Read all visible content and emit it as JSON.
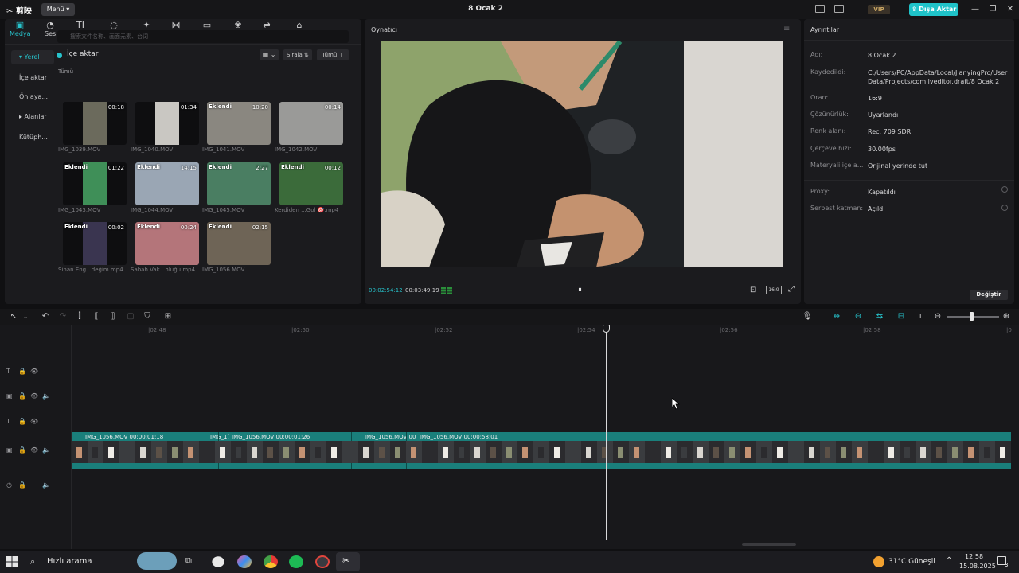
{
  "app": {
    "logo": "✂ 剪映",
    "menu_label": "Menü ▾",
    "project_title": "8 Ocak 2",
    "vip": "VIP",
    "export_label": "⇪ Dışa Aktar"
  },
  "top_tabs": [
    {
      "icon": "▣",
      "label": "Medya",
      "active": true
    },
    {
      "icon": "◔",
      "label": "Ses"
    },
    {
      "icon": "TI",
      "label": "Metin"
    },
    {
      "icon": "◌",
      "label": "Çıkartmalar"
    },
    {
      "icon": "✦",
      "label": "Efektler"
    },
    {
      "icon": "⋈",
      "label": "Geçişler"
    },
    {
      "icon": "▭",
      "label": "Yazılar"
    },
    {
      "icon": "❀",
      "label": "Filtreler"
    },
    {
      "icon": "⇌",
      "label": "Ayar"
    },
    {
      "icon": "⌂",
      "label": "Şablonlar"
    }
  ],
  "side_nav": [
    "▾ Yerel",
    "İçe aktar",
    "Ön aya...",
    "▸ Alanlar",
    "Kütüph..."
  ],
  "media": {
    "search_placeholder": "搜索文件名称、画面元素、台词",
    "import_label": "İçe aktar",
    "view_icon": "▦ ⌄",
    "sort_label": "Sırala ⇅",
    "filter_label": "Tümü ⊤",
    "all_label": "Tümü",
    "clips": [
      {
        "name": "IMG_1039.MOV",
        "duration": "00:18",
        "badge": "",
        "bg": "#6b6a5c"
      },
      {
        "name": "IMG_1040.MOV",
        "duration": "01:34",
        "badge": "",
        "bg": "#c9c7c2"
      },
      {
        "name": "IMG_1041.MOV",
        "duration": "10:20",
        "badge": "Eklendi",
        "bg": "#8a8780"
      },
      {
        "name": "IMG_1042.MOV",
        "duration": "00:14",
        "badge": "",
        "bg": "#9a9a98"
      },
      {
        "name": "IMG_1043.MOV",
        "duration": "01:22",
        "badge": "Eklendi",
        "bg": "#3f8f58"
      },
      {
        "name": "IMG_1044.MOV",
        "duration": "14:15",
        "badge": "Eklendi",
        "bg": "#9aa6b4"
      },
      {
        "name": "IMG_1045.MOV",
        "duration": "2:27",
        "badge": "Eklendi",
        "bg": "#4a7e62"
      },
      {
        "name": "Kerdiden ...Gol 🎯.mp4",
        "duration": "00:12",
        "badge": "Eklendi",
        "bg": "#3b6b3a"
      },
      {
        "name": "Sinan Eng...değim.mp4",
        "duration": "00:02",
        "badge": "Eklendi",
        "bg": "#3a3550"
      },
      {
        "name": "Sabah Vak...hluğu.mp4",
        "duration": "00:24",
        "badge": "Eklendi",
        "bg": "#b4757a"
      },
      {
        "name": "IMG_1056.MOV",
        "duration": "02:15",
        "badge": "Eklendi",
        "bg": "#6e6456"
      }
    ]
  },
  "player": {
    "title": "Oynatıcı",
    "menu_icon": "≡",
    "time_current": "00:02:54:12",
    "time_total": "00:03:49:19",
    "pause_icon": "⏸",
    "snap_icon": "⊡",
    "ratio_label": "16:9",
    "fullscreen_icon": "⤢"
  },
  "details": {
    "title": "Ayrıntılar",
    "rows": [
      {
        "label": "Adı:",
        "value": "8 Ocak 2"
      },
      {
        "label": "Kaydedildi:",
        "value": "C:/Users/PC/AppData/Local/JianyingPro/User Data/Projects/com.lveditor.draft/8 Ocak 2"
      },
      {
        "label": "Oran:",
        "value": "16:9"
      },
      {
        "label": "Çözünürlük:",
        "value": "Uyarlandı"
      },
      {
        "label": "Renk alanı:",
        "value": "Rec. 709 SDR"
      },
      {
        "label": "Çerçeve hızı:",
        "value": "30.00fps"
      },
      {
        "label": "Materyali içe a...",
        "value": "Orijinal yerinde tut"
      }
    ],
    "rows2": [
      {
        "label": "Proxy:",
        "value": "Kapatıldı"
      },
      {
        "label": "Serbest katman:",
        "value": "Açıldı"
      }
    ],
    "change_label": "Değiştir"
  },
  "timeline": {
    "ticks": [
      "|02:48",
      "|02:50",
      "|02:52",
      "|02:54",
      "|02:56",
      "|02:58",
      "|0"
    ],
    "segments": [
      {
        "label": "IMG_1056.MOV   00:00:01:18"
      },
      {
        "label": "IMG_1("
      },
      {
        "label": "IMG_1056.MOV   00:00:01:26"
      },
      {
        "label": "IMG_1056.MOV   00"
      },
      {
        "label": "IMG_1056.MOV   00:00:58:01"
      }
    ]
  },
  "taskbar": {
    "search_label": "Hızlı arama",
    "weather": "31°C  Güneşli",
    "time": "12:58",
    "date": "15.08.2025",
    "notif_count": "3"
  },
  "colors": {
    "accent": "#27c2cb",
    "track": "#1a7f7b",
    "panel": "#1b1b1e"
  }
}
